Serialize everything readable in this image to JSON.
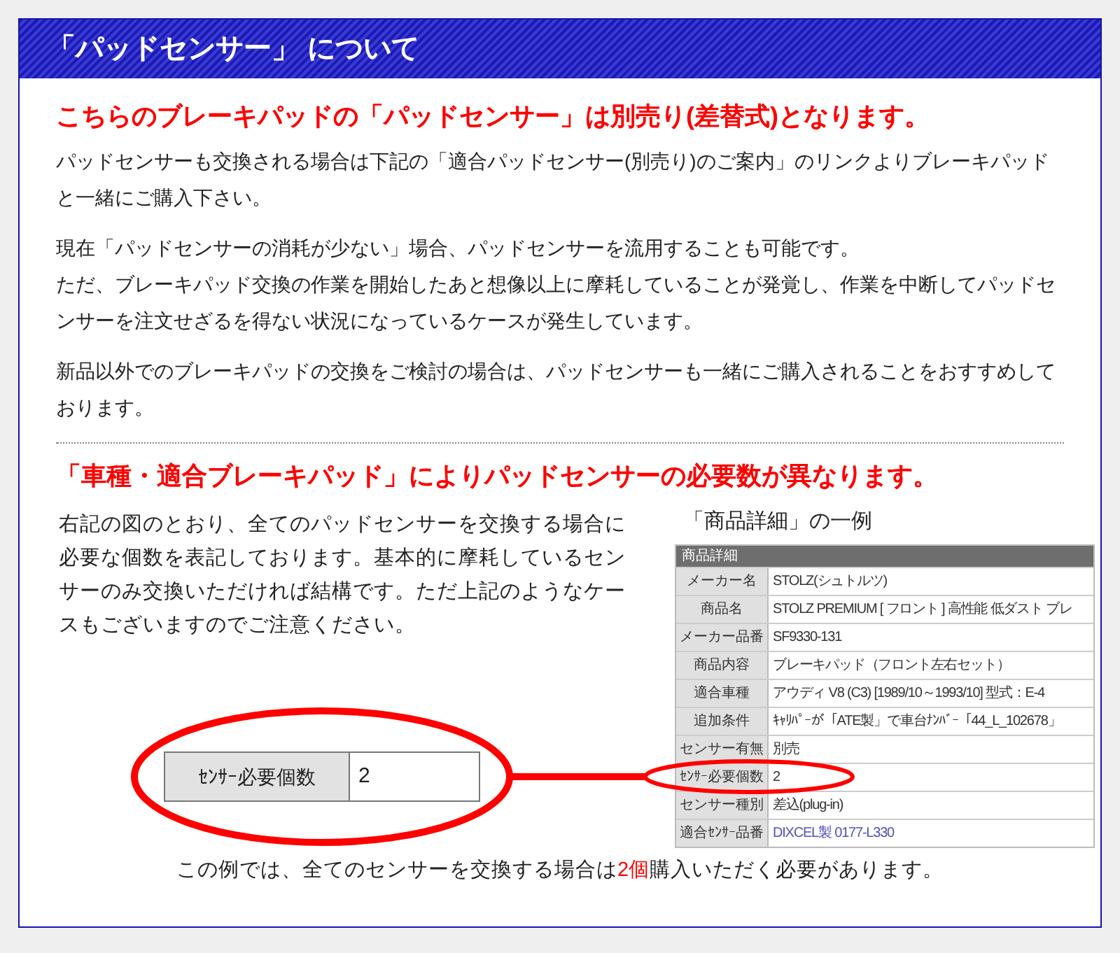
{
  "header": {
    "title": "「パッドセンサー」 について"
  },
  "notice": "こちらのブレーキパッドの「パッドセンサー」は別売り(差替式)となります。",
  "paragraphs": [
    {
      "lines": [
        "パッドセンサーも交換される場合は下記の「適合パッドセンサー(別売り)のご案内」のリンクよりブレーキパッドと一緒にご購入下さい。"
      ]
    },
    {
      "lines": [
        "現在「パッドセンサーの消耗が少ない」場合、パッドセンサーを流用することも可能です。",
        "ただ、ブレーキパッド交換の作業を開始したあと想像以上に摩耗していることが発覚し、作業を中断してパッドセンサーを注文せざるを得ない状況になっているケースが発生しています。"
      ]
    },
    {
      "lines": [
        "新品以外でのブレーキパッドの交換をご検討の場合は、パッドセンサーも一緒にご購入されることをおすすめしております。"
      ]
    }
  ],
  "section_heading": "「車種・適合ブレーキパッド」によりパッドセンサーの必要数が異なります。",
  "explanation": "右記の図のとおり、全てのパッドセンサーを交換する場合に必要な個数を表記しております。基本的に摩耗しているセンサーのみ交換いただければ結構です。ただ上記のようなケースもございますのでご注意ください。",
  "example": {
    "caption": "「商品詳細」の一例",
    "table_title": "商品詳細",
    "rows": [
      {
        "label": "メーカー名",
        "value": "STOLZ(シュトルツ)",
        "kind": "text"
      },
      {
        "label": "商品名",
        "value": "STOLZ PREMIUM [ フロント ] 高性能 低ダスト ブレ",
        "kind": "text"
      },
      {
        "label": "メーカー品番",
        "value": "SF9330-131",
        "kind": "text"
      },
      {
        "label": "商品内容",
        "value": "ブレーキパッド（フロント左右セット）",
        "kind": "text"
      },
      {
        "label": "適合車種",
        "value": "アウディ V8 (C3) [1989/10～1993/10] 型式：E-4",
        "kind": "text"
      },
      {
        "label": "追加条件",
        "value": "ｷｬﾘﾊﾟｰが「ATE製」で車台ﾅﾝﾊﾞｰ「44_L_102678」",
        "kind": "text"
      },
      {
        "label": "センサー有無",
        "value": "別売",
        "kind": "text"
      },
      {
        "label": "ｾﾝｻｰ必要個数",
        "value": "2",
        "kind": "text"
      },
      {
        "label": "センサー種別",
        "value": "差込(plug-in)",
        "kind": "text"
      },
      {
        "label": "適合ｾﾝｻｰ品番",
        "value": "DIXCEL製 0177-L330",
        "kind": "link"
      }
    ]
  },
  "highlight_field": {
    "label": "ｾﾝｻｰ必要個数",
    "value": "2"
  },
  "note": {
    "before": "この例では、全てのセンサーを交換する場合は",
    "highlight": "2個",
    "after": "購入いただく必要があります。"
  }
}
